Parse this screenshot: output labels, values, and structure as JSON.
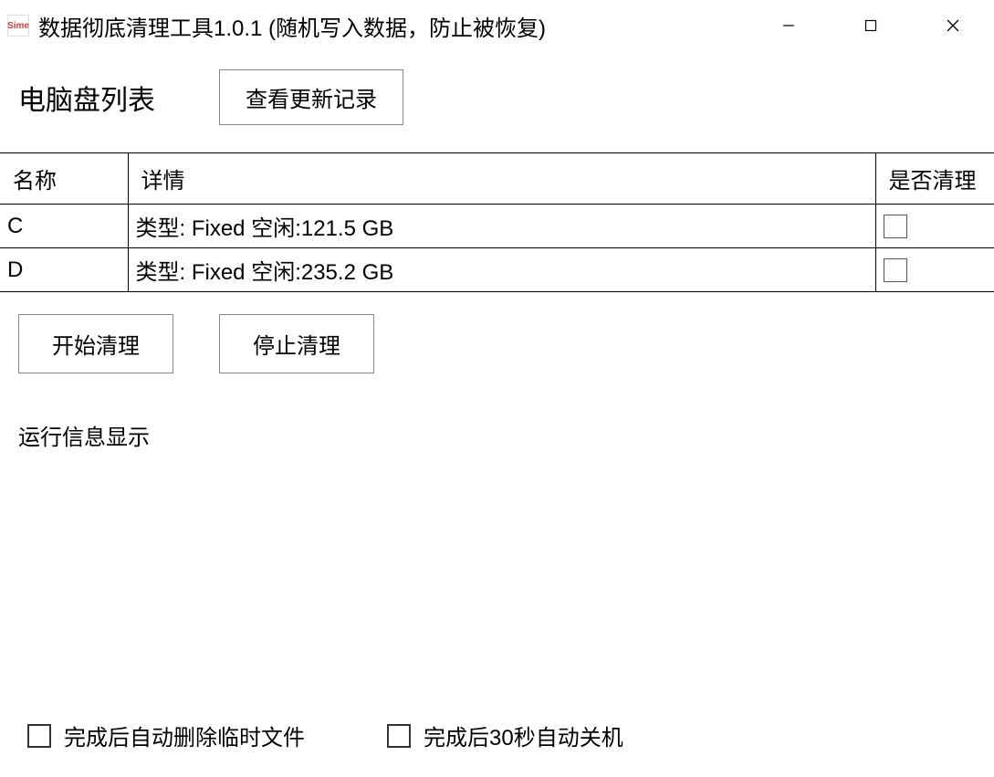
{
  "window": {
    "title": "数据彻底清理工具1.0.1 (随机写入数据，防止被恢复)",
    "icon_label": "Sime"
  },
  "header": {
    "title": "电脑盘列表",
    "changelog_button": "查看更新记录"
  },
  "table": {
    "columns": {
      "name": "名称",
      "detail": "详情",
      "clean": "是否清理"
    },
    "rows": [
      {
        "name": "C",
        "detail": "类型: Fixed 空闲:121.5 GB",
        "clean": false
      },
      {
        "name": "D",
        "detail": "类型: Fixed 空闲:235.2 GB",
        "clean": false
      }
    ]
  },
  "actions": {
    "start": "开始清理",
    "stop": "停止清理"
  },
  "runtime_label": "运行信息显示",
  "options": {
    "auto_delete_temp": "完成后自动删除临时文件",
    "auto_shutdown": "完成后30秒自动关机"
  }
}
